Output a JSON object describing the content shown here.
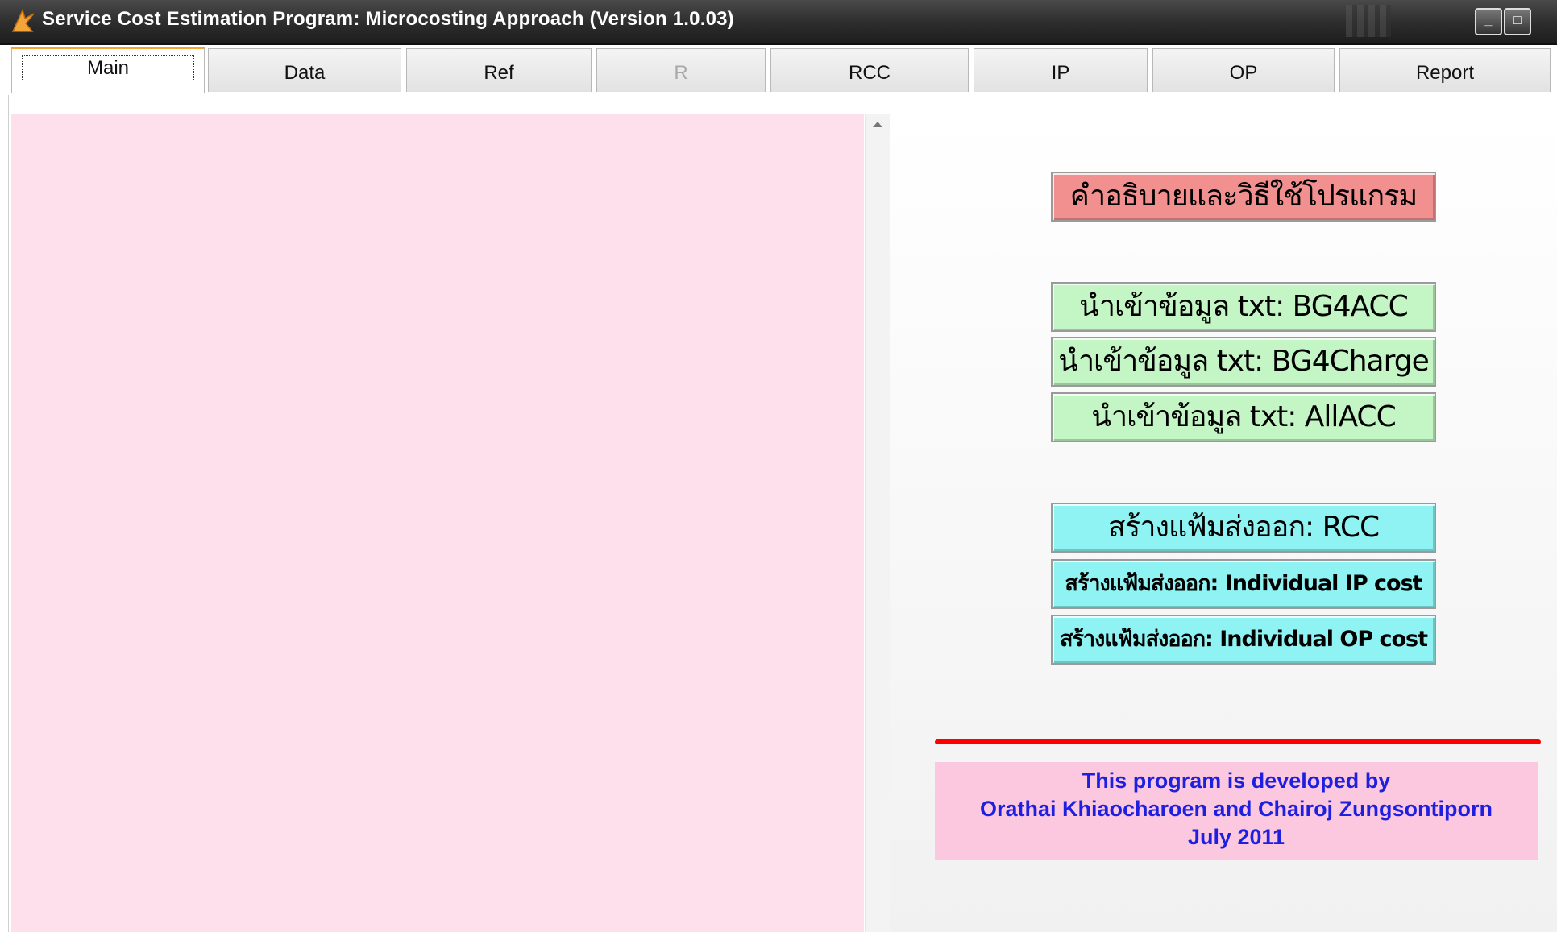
{
  "window": {
    "title": "Service Cost Estimation Program: Microcosting Approach (Version 1.0.03)",
    "controls": {
      "minimize": "_",
      "maximize": "□"
    }
  },
  "tabs": [
    {
      "label": "Main",
      "state": "active"
    },
    {
      "label": "Data",
      "state": "normal"
    },
    {
      "label": "Ref",
      "state": "normal"
    },
    {
      "label": "R",
      "state": "disabled"
    },
    {
      "label": "RCC",
      "state": "normal"
    },
    {
      "label": "IP",
      "state": "normal"
    },
    {
      "label": "OP",
      "state": "normal"
    },
    {
      "label": "Report",
      "state": "normal"
    }
  ],
  "buttons": {
    "help": "คำอธิบายและวิธีใช้โปรแกรม",
    "import_bg4acc": "นำเข้าข้อมูล txt: BG4ACC",
    "import_bg4charge": "นำเข้าข้อมูล txt: BG4Charge",
    "import_allacc": "นำเข้าข้อมูล txt: AllACC",
    "export_rcc": "สร้างแฟ้มส่งออก: RCC",
    "export_ip": "สร้างแฟ้มส่งออก: Individual IP cost",
    "export_op": "สร้างแฟ้มส่งออก: Individual OP cost"
  },
  "credit": {
    "line1": "This program is developed  by",
    "line2": "Orathai Khiaocharoen and Chairoj Zungsontiporn",
    "line3": "July 2011"
  },
  "colors": {
    "help_button": "#f29090",
    "import_buttons": "#c4f5c4",
    "export_buttons": "#90f3f3",
    "credit_bg": "#fcc8e0",
    "credit_text": "#1f1fe0",
    "divider": "#ff0000",
    "left_panel": "#fde0ec"
  },
  "icons": [
    "app-logo-icon",
    "minimize-icon",
    "maximize-icon",
    "scroll-up-icon"
  ]
}
